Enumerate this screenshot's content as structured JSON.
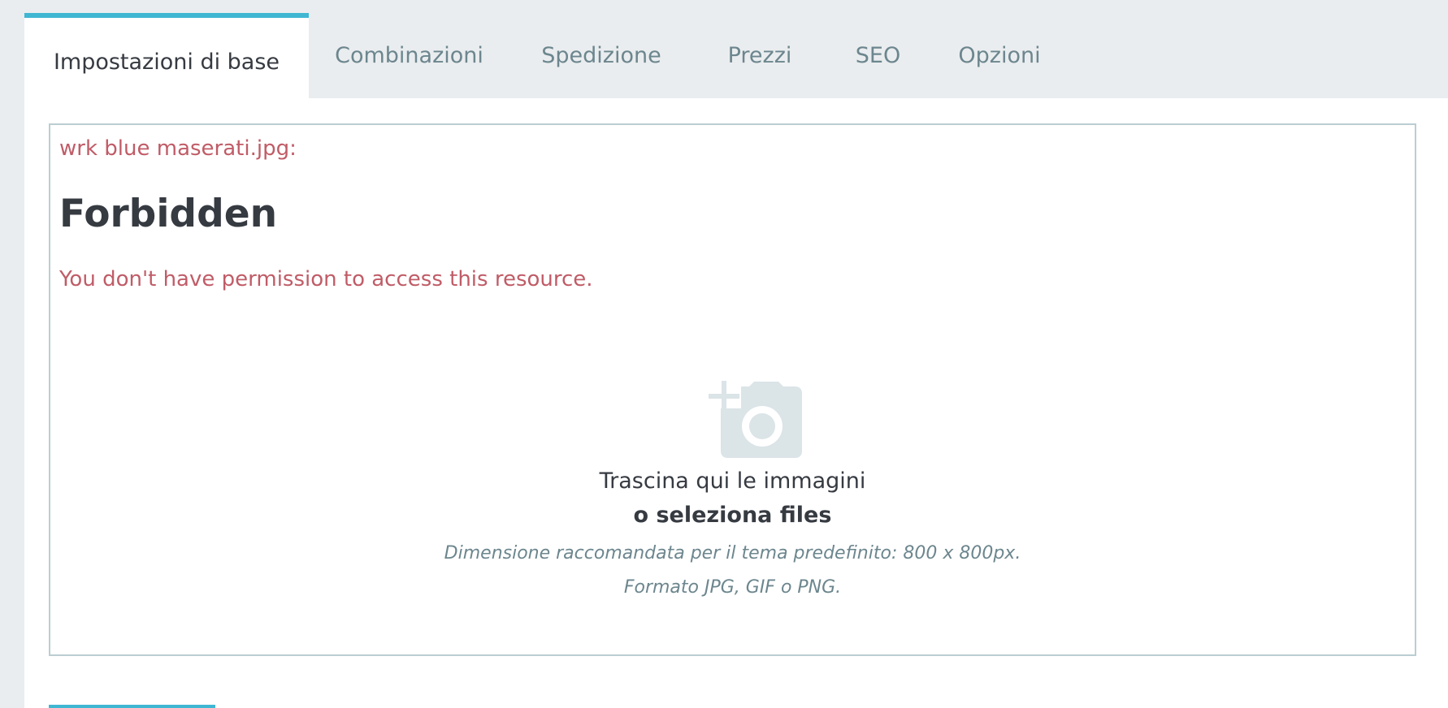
{
  "tabs": [
    {
      "label": "Impostazioni di base",
      "active": true
    },
    {
      "label": "Combinazioni",
      "active": false
    },
    {
      "label": "Spedizione",
      "active": false
    },
    {
      "label": "Prezzi",
      "active": false
    },
    {
      "label": "SEO",
      "active": false
    },
    {
      "label": "Opzioni",
      "active": false
    }
  ],
  "error": {
    "file": "wrk blue maserati.jpg:",
    "title": "Forbidden",
    "message": "You don't have permission to access this resource."
  },
  "dropzone": {
    "icon": "add-photo-icon",
    "drag_text": "Trascina qui le immagini",
    "select_text": "o seleziona files",
    "size_hint": "Dimensione raccomandata per il tema predefinito: 800 x 800px.",
    "format_hint": "Formato JPG, GIF o PNG."
  },
  "colors": {
    "accent": "#3fb7d2",
    "error": "#c05c67",
    "text_dark": "#363a41",
    "text_muted": "#6c868e",
    "border": "#bbcdd2",
    "background": "#eaedef"
  }
}
